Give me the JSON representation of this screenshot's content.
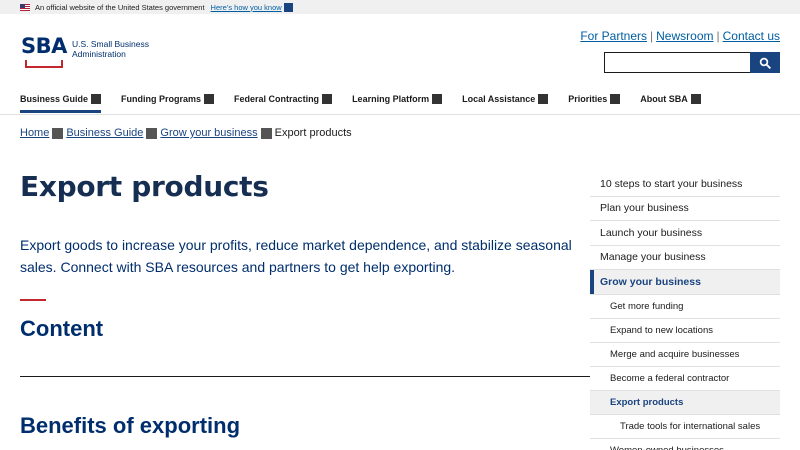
{
  "gov_banner": {
    "text": "An official website of the United States government",
    "link": "Here’s how you know"
  },
  "logo": {
    "mark": "SBA",
    "line1": "U.S. Small Business",
    "line2": "Administration"
  },
  "utility_links": [
    "For Partners",
    "Newsroom",
    "Contact us"
  ],
  "search": {
    "placeholder": ""
  },
  "main_nav": [
    "Business Guide",
    "Funding Programs",
    "Federal Contracting",
    "Learning Platform",
    "Local Assistance",
    "Priorities",
    "About SBA"
  ],
  "breadcrumb": {
    "items": [
      "Home",
      "Business Guide",
      "Grow your business"
    ],
    "current": "Export products"
  },
  "page": {
    "title": "Export products",
    "intro": "Export goods to increase your profits, reduce market dependence, and stabilize seasonal sales. Connect with SBA resources and partners to get help exporting.",
    "content_heading": "Content",
    "section_heading": "Benefits of exporting"
  },
  "sidenav": [
    {
      "label": "10 steps to start your business"
    },
    {
      "label": "Plan your business"
    },
    {
      "label": "Launch your business"
    },
    {
      "label": "Manage your business"
    },
    {
      "label": "Grow your business"
    },
    {
      "label": "Get more funding"
    },
    {
      "label": "Expand to new locations"
    },
    {
      "label": "Merge and acquire businesses"
    },
    {
      "label": "Become a federal contractor"
    },
    {
      "label": "Export products"
    },
    {
      "label": "Trade tools for international sales"
    },
    {
      "label": "Women-owned businesses"
    }
  ],
  "colors": {
    "primary": "#1a4480",
    "title": "#162e51",
    "accent_red": "#c1272d",
    "link": "#005ea2"
  },
  "icons": [
    "us-flag-icon",
    "search-icon",
    "chevron-square-icon"
  ]
}
